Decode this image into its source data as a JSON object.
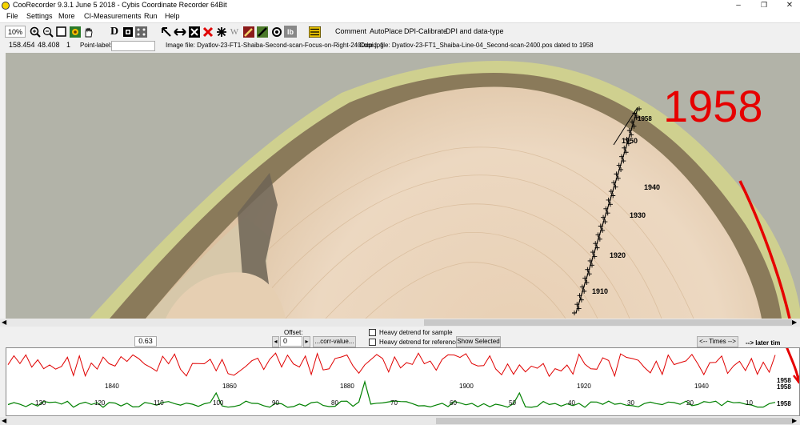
{
  "window": {
    "title": "CooRecorder 9.3.1 June 5 2018 - Cybis Coordinate Recorder  64Bit",
    "minimize": "–",
    "maximize": "❐",
    "close": "✕"
  },
  "menu": [
    "File",
    "Settings",
    "More",
    "CI-Measurements",
    "Run",
    "Help"
  ],
  "toolbar": {
    "zoom": "10%",
    "text_buttons": [
      "Comment",
      "AutoPlace",
      "DPI-Calibrate",
      "DPI and data-type"
    ],
    "icons": [
      "zoom-in-icon",
      "zoom-out-icon",
      "frame-icon",
      "sunflower-icon",
      "hand-icon",
      "d-icon",
      "marker-icon",
      "points-icon",
      "arrow-icon",
      "double-arrow-icon",
      "cross-icon",
      "asterisk-icon",
      "w-icon",
      "edit-icon",
      "line-icon",
      "target-icon",
      "lb-icon",
      "list-icon"
    ]
  },
  "infobar": {
    "x": "158.454",
    "y": "48.408",
    "count": "1",
    "point_label": "Point-label:",
    "point_label_value": "",
    "image_file": "Image file: Dyatlov-23-FT1-Shaiba-Second-scan-Focus-on-Right-2400dpi.jpg",
    "coord_file": "Coord. file: Dyatlov-23-FT1_Shaiba-Line-04_Second-scan-2400.pos dated to 1958"
  },
  "image": {
    "annotation": "1958",
    "annotation_color": "#e60000",
    "year_labels": [
      {
        "year": "1958",
        "decade": false
      },
      {
        "year": "1950",
        "decade": true
      },
      {
        "year": "1940",
        "decade": true
      },
      {
        "year": "1930",
        "decade": true
      },
      {
        "year": "1920",
        "decade": true
      },
      {
        "year": "1910",
        "decade": true
      }
    ]
  },
  "controls": {
    "correlation": "0.63",
    "offset_label": "Offset:",
    "offset_value": "0",
    "corr_value": "...corr-value...",
    "heavy_sample": "Heavy detrend for sample",
    "heavy_reference": "Heavy detrend for reference",
    "show_selected": "Show Selected",
    "times_button": "<-- Times -->",
    "later_times": "--> later tim"
  },
  "graph": {
    "red_color": "#e00000",
    "green_color": "#008000",
    "top_labels": [
      "1840",
      "1860",
      "1880",
      "1900",
      "1920",
      "1940"
    ],
    "bottom_labels": [
      "130",
      "120",
      "110",
      "100",
      "90",
      "80",
      "70",
      "60",
      "50",
      "40",
      "30",
      "20",
      "10"
    ],
    "end_label_top": "1958",
    "end_label_mid": "1958",
    "end_label_bottom": "1958"
  }
}
